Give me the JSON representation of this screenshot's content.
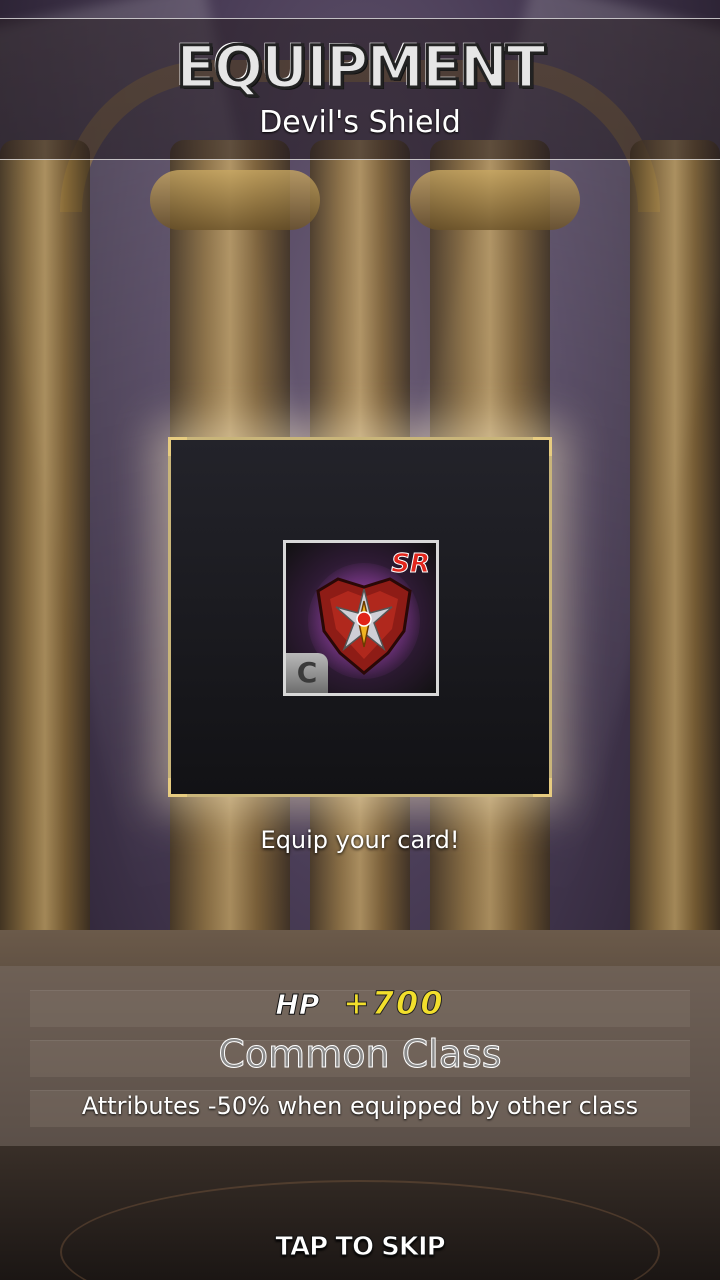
{
  "header": {
    "title": "EQUIPMENT",
    "item_name": "Devil's Shield"
  },
  "card": {
    "rarity": "SR",
    "class_badge": "C",
    "icon": "demon-shield-icon"
  },
  "prompt": "Equip your card!",
  "stats": {
    "hp_label": "HP",
    "hp_value": "+700",
    "class_name": "Common Class",
    "attribute_note": "Attributes -50% when equipped by other class"
  },
  "footer": {
    "skip_label": "TAP TO SKIP"
  },
  "colors": {
    "rarity": "#e2261d",
    "hp_value": "#f2df2c",
    "frame_gold": "#c9b57a"
  }
}
